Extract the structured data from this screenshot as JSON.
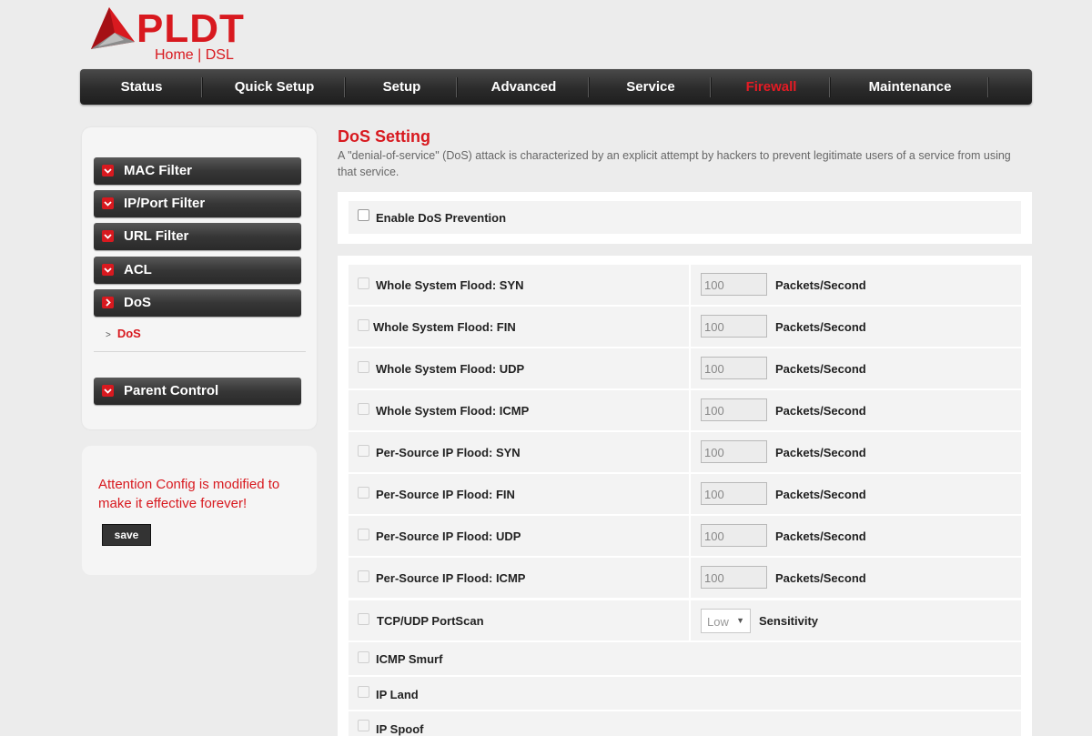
{
  "brand": {
    "name": "PLDT",
    "sub": "Home | DSL"
  },
  "nav": [
    "Status",
    "Quick Setup",
    "Setup",
    "Advanced",
    "Service",
    "Firewall",
    "Maintenance"
  ],
  "nav_active": "Firewall",
  "sidebar": {
    "items": [
      "MAC Filter",
      "IP/Port Filter",
      "URL Filter",
      "ACL",
      "DoS",
      "Parent Control"
    ],
    "sub_item": "DoS"
  },
  "attention": {
    "text": "Attention Config is modified to make it effective forever!",
    "save_label": "save"
  },
  "main": {
    "title": "DoS Setting",
    "description": "A \"denial-of-service\" (DoS) attack is characterized by an explicit attempt by hackers to prevent legitimate users of a service from using that service.",
    "enable_label": "Enable DoS Prevention",
    "flood_rows": [
      {
        "label": "Whole System Flood: SYN",
        "value": "100"
      },
      {
        "label": "Whole System Flood: FIN",
        "value": "100"
      },
      {
        "label": "Whole System Flood: UDP",
        "value": "100"
      },
      {
        "label": "Whole System Flood: ICMP",
        "value": "100"
      },
      {
        "label": "Per-Source IP Flood: SYN",
        "value": "100"
      },
      {
        "label": "Per-Source IP Flood: FIN",
        "value": "100"
      },
      {
        "label": "Per-Source IP Flood: UDP",
        "value": "100"
      },
      {
        "label": "Per-Source IP Flood: ICMP",
        "value": "100"
      }
    ],
    "unit": "Packets/Second",
    "portscan": {
      "label": "TCP/UDP PortScan",
      "sensitivity_value": "Low",
      "sensitivity_label": "Sensitivity"
    },
    "other_rows": [
      "ICMP Smurf",
      "IP Land",
      "IP Spoof"
    ]
  },
  "colors": {
    "accent": "#d8191f",
    "nav_bg": "#2b2b2b"
  }
}
